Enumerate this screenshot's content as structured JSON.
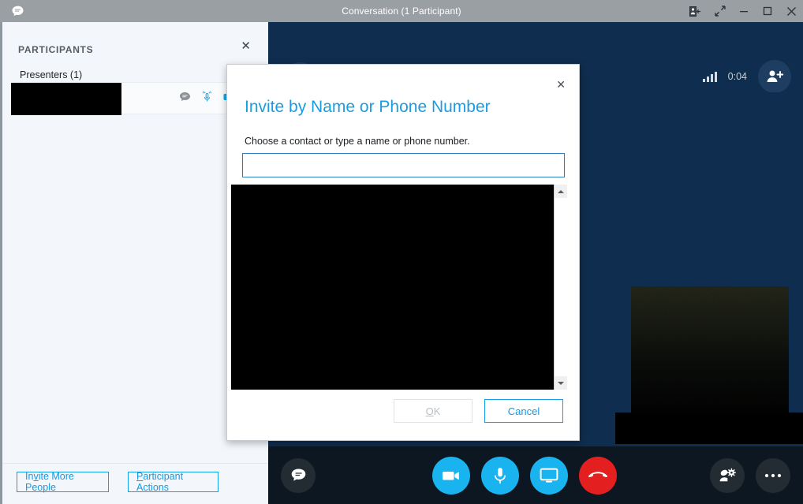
{
  "window": {
    "title": "Conversation (1 Participant)",
    "app_icon": "chat-bubble-icon",
    "controls": {
      "dock_panel": "dock-panel-icon",
      "popout": "popout-arrows-icon",
      "minimize": "minimize-icon",
      "maximize": "maximize-icon",
      "close": "close-icon"
    }
  },
  "participants_panel": {
    "title": "PARTICIPANTS",
    "close_label": "✕",
    "group_label": "Presenters (1)",
    "row": {
      "name": "",
      "icons": [
        "chat-bubble-icon",
        "microphone-active-icon",
        "video-camera-icon"
      ]
    },
    "footer": {
      "invite_more_people": "Invite More People",
      "invite_more_people_accel": "v",
      "participant_actions": "Participant Actions",
      "participant_actions_accel": "P"
    }
  },
  "conversation": {
    "header": {
      "avatar_icon": "people-group-icon",
      "title": "1 Participant",
      "signal_icon": "signal-bars-icon",
      "timer": "0:04",
      "add_person_icon": "add-person-icon"
    },
    "toolbar": {
      "left": [
        {
          "name": "chat-button",
          "icon": "chat-bubble-icon",
          "style": "dark",
          "size": 44
        }
      ],
      "center": [
        {
          "name": "video-button",
          "icon": "video-camera-icon",
          "style": "blue",
          "size": 48
        },
        {
          "name": "microphone-button",
          "icon": "microphone-icon",
          "style": "blue",
          "size": 48
        },
        {
          "name": "share-screen-button",
          "icon": "monitor-icon",
          "style": "blue",
          "size": 48
        },
        {
          "name": "end-call-button",
          "icon": "hangup-phone-icon",
          "style": "red",
          "size": 48
        }
      ],
      "right": [
        {
          "name": "manage-participants-button",
          "icon": "person-gear-icon",
          "style": "dark",
          "size": 44
        },
        {
          "name": "more-options-button",
          "icon": "ellipsis-icon",
          "style": "dark",
          "size": 44
        }
      ]
    }
  },
  "dialog": {
    "close_label": "✕",
    "title": "Invite by Name or Phone Number",
    "instruction": "Choose a contact or type a name or phone number.",
    "input_value": "",
    "input_placeholder": "",
    "contact_list": [],
    "buttons": {
      "ok": "OK",
      "ok_accel": "O",
      "ok_enabled": false,
      "cancel": "Cancel"
    }
  },
  "colors": {
    "titlebar": "#9a9fa3",
    "panel_background": "#f3f7fb",
    "conversation_background": "#0f2d4e",
    "toolbar_background": "#0c1721",
    "accent_blue": "#19b3ef",
    "link_blue": "#1699e0",
    "end_call_red": "#e41f1f",
    "dialog_title_blue": "#1c9ce0"
  }
}
